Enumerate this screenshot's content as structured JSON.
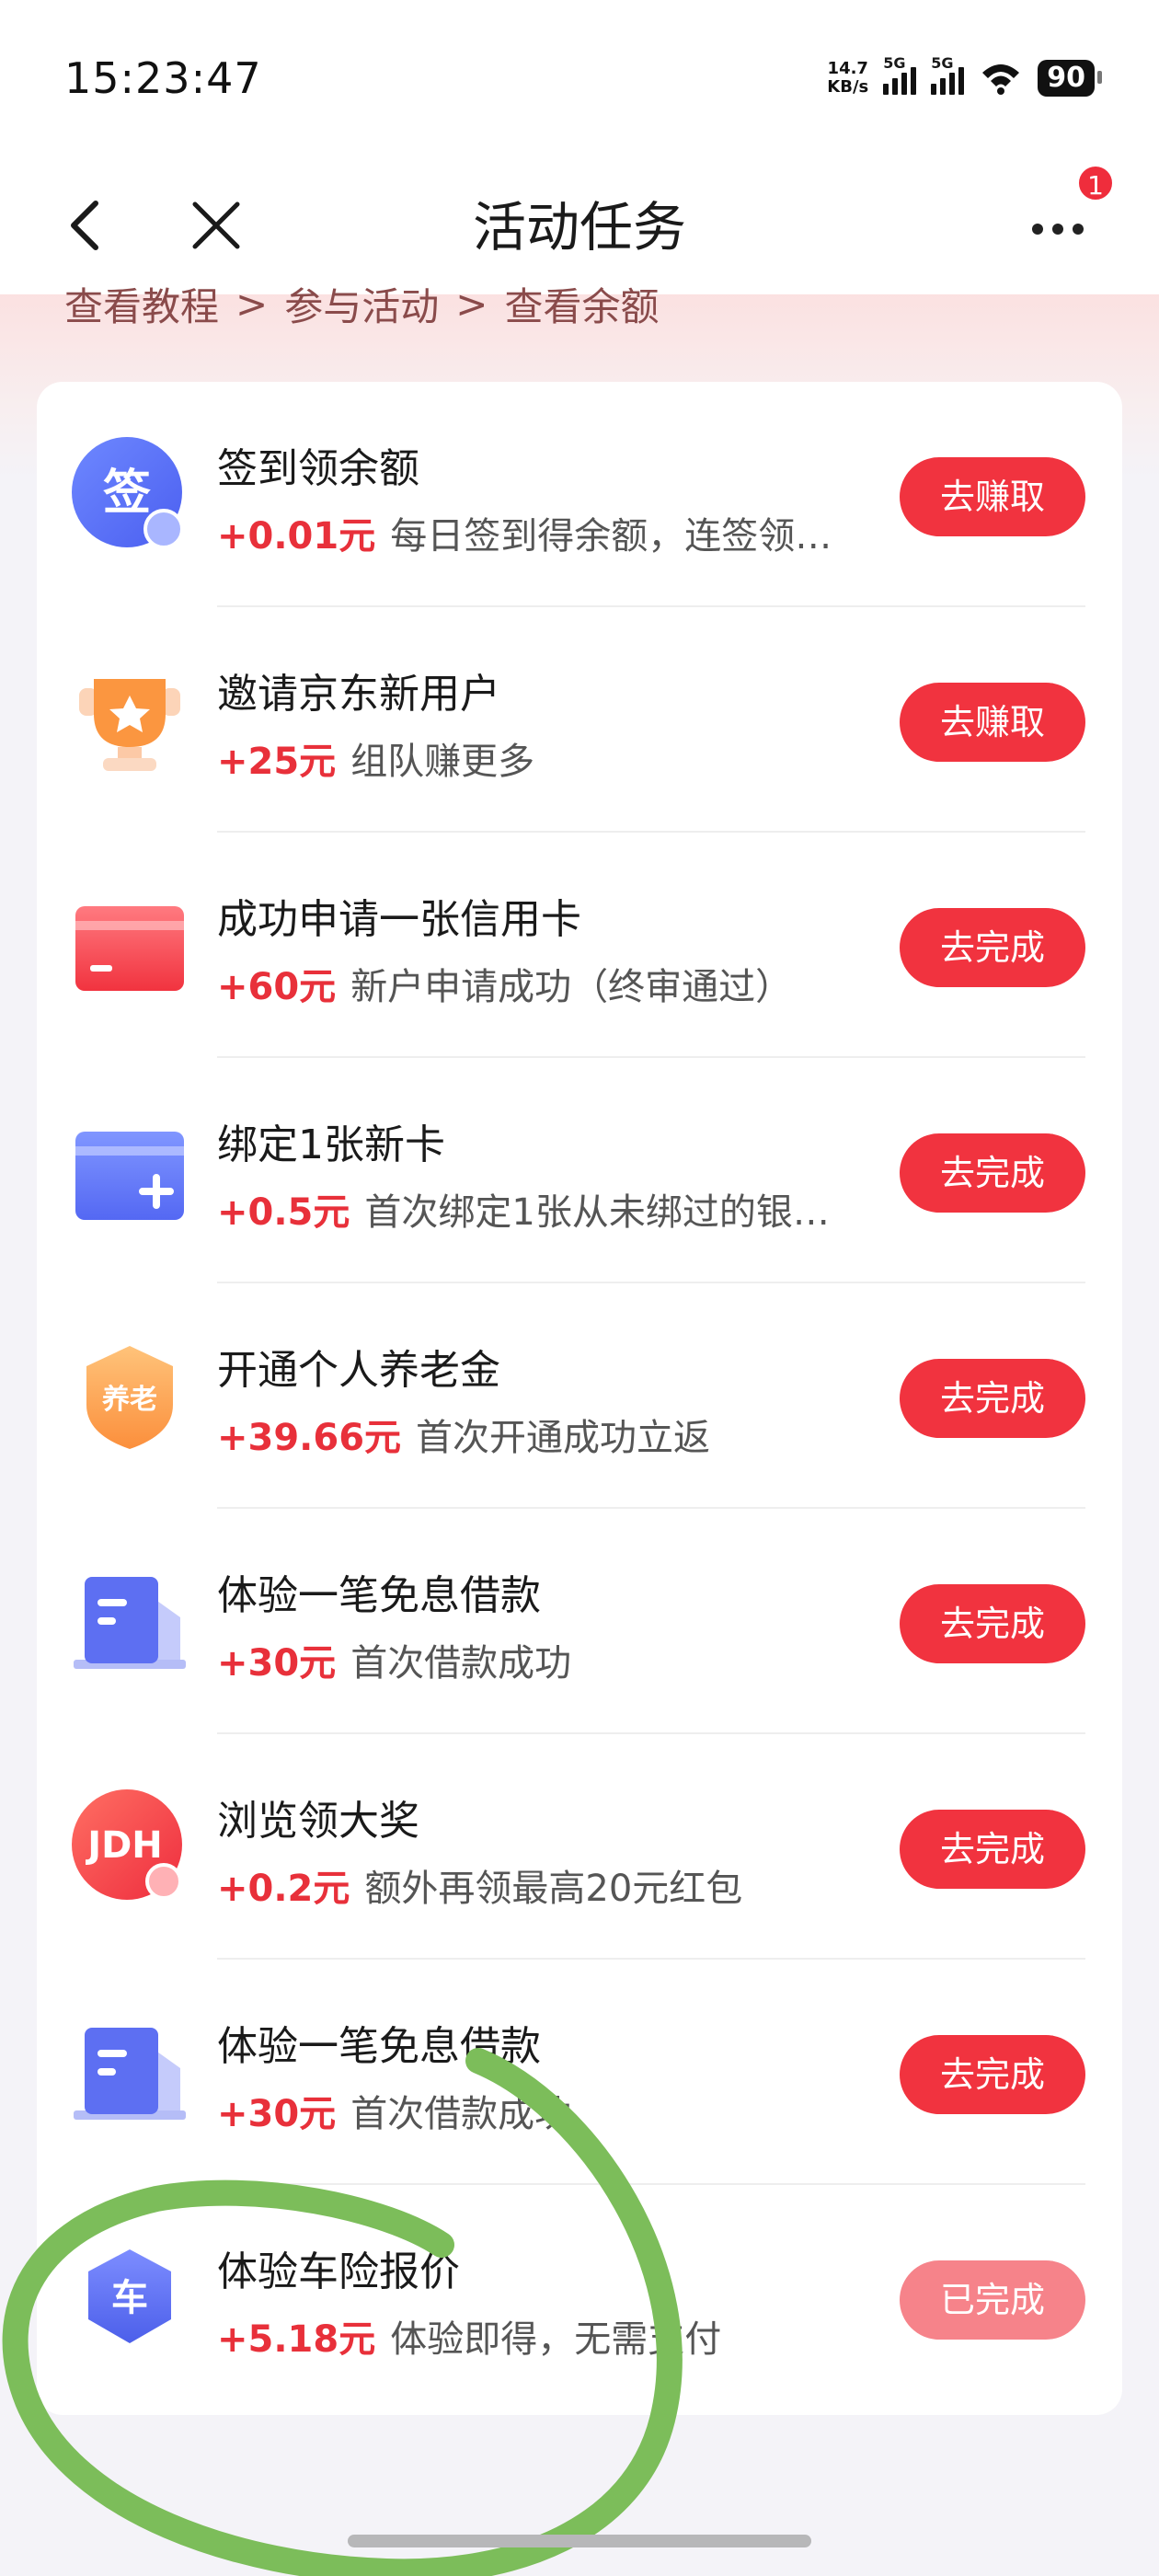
{
  "status": {
    "time": "15:23:47",
    "net_speed_value": "14.7",
    "net_speed_unit": "KB/s",
    "signal1_label": "5G",
    "signal2_label": "5G",
    "battery": "90",
    "icons": [
      "signal-icon",
      "signal-icon",
      "wifi-icon",
      "battery-icon"
    ]
  },
  "nav": {
    "title": "活动任务",
    "badge": "1",
    "icons": [
      "back-icon",
      "close-icon",
      "more-icon"
    ]
  },
  "breadcrumb": [
    "查看教程",
    "参与活动",
    "查看余额"
  ],
  "breadcrumb_sep": ">",
  "tasks": [
    {
      "title": "签到领余额",
      "amount": "+0.01元",
      "desc": "每日签到得余额，连签领…",
      "button": "去赚取",
      "icon": "sign-in-icon",
      "icon_text": "签",
      "state": "active"
    },
    {
      "title": "邀请京东新用户",
      "amount": "+25元",
      "desc": "组队赚更多",
      "button": "去赚取",
      "icon": "trophy-icon",
      "state": "active"
    },
    {
      "title": "成功申请一张信用卡",
      "amount": "+60元",
      "desc": "新户申请成功（终审通过）",
      "button": "去完成",
      "icon": "credit-card-icon",
      "state": "active"
    },
    {
      "title": "绑定1张新卡",
      "amount": "+0.5元",
      "desc": "首次绑定1张从未绑过的银…",
      "button": "去完成",
      "icon": "add-card-icon",
      "state": "active"
    },
    {
      "title": "开通个人养老金",
      "amount": "+39.66元",
      "desc": "首次开通成功立返",
      "button": "去完成",
      "icon": "pension-icon",
      "icon_text": "养老",
      "state": "active"
    },
    {
      "title": "体验一笔免息借款",
      "amount": "+30元",
      "desc": "首次借款成功",
      "button": "去完成",
      "icon": "loan-document-icon",
      "state": "active"
    },
    {
      "title": "浏览领大奖",
      "amount": "+0.2元",
      "desc": "额外再领最高20元红包",
      "button": "去完成",
      "icon": "jdh-icon",
      "icon_text": "JDH",
      "state": "active"
    },
    {
      "title": "体验一笔免息借款",
      "amount": "+30元",
      "desc": "首次借款成功",
      "button": "去完成",
      "icon": "loan-document-icon",
      "state": "active"
    },
    {
      "title": "体验车险报价",
      "amount": "+5.18元",
      "desc": "体验即得，无需支付",
      "button": "已完成",
      "icon": "car-insurance-icon",
      "icon_text": "车",
      "state": "done"
    }
  ],
  "colors": {
    "accent_red": "#f1333f",
    "amount_red": "#e8303a",
    "done_button": "#f6838a",
    "annotation_green": "#7cbd5a"
  }
}
